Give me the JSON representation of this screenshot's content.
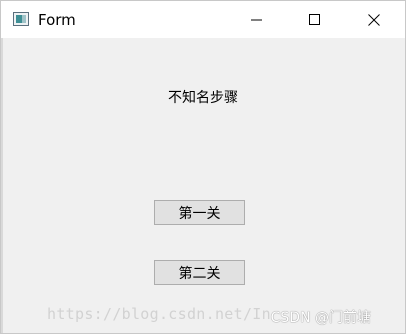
{
  "window": {
    "title": "Form",
    "icon": "form-app-icon",
    "controls": {
      "minimize": "minimize-icon",
      "maximize": "maximize-icon",
      "close": "close-icon"
    }
  },
  "main": {
    "label": "不知名步骤",
    "buttons": [
      {
        "label": "第一关"
      },
      {
        "label": "第二关"
      }
    ]
  },
  "watermark": {
    "url": "https://blog.csdn.net/In",
    "credit": "CSDN @门前塘"
  }
}
